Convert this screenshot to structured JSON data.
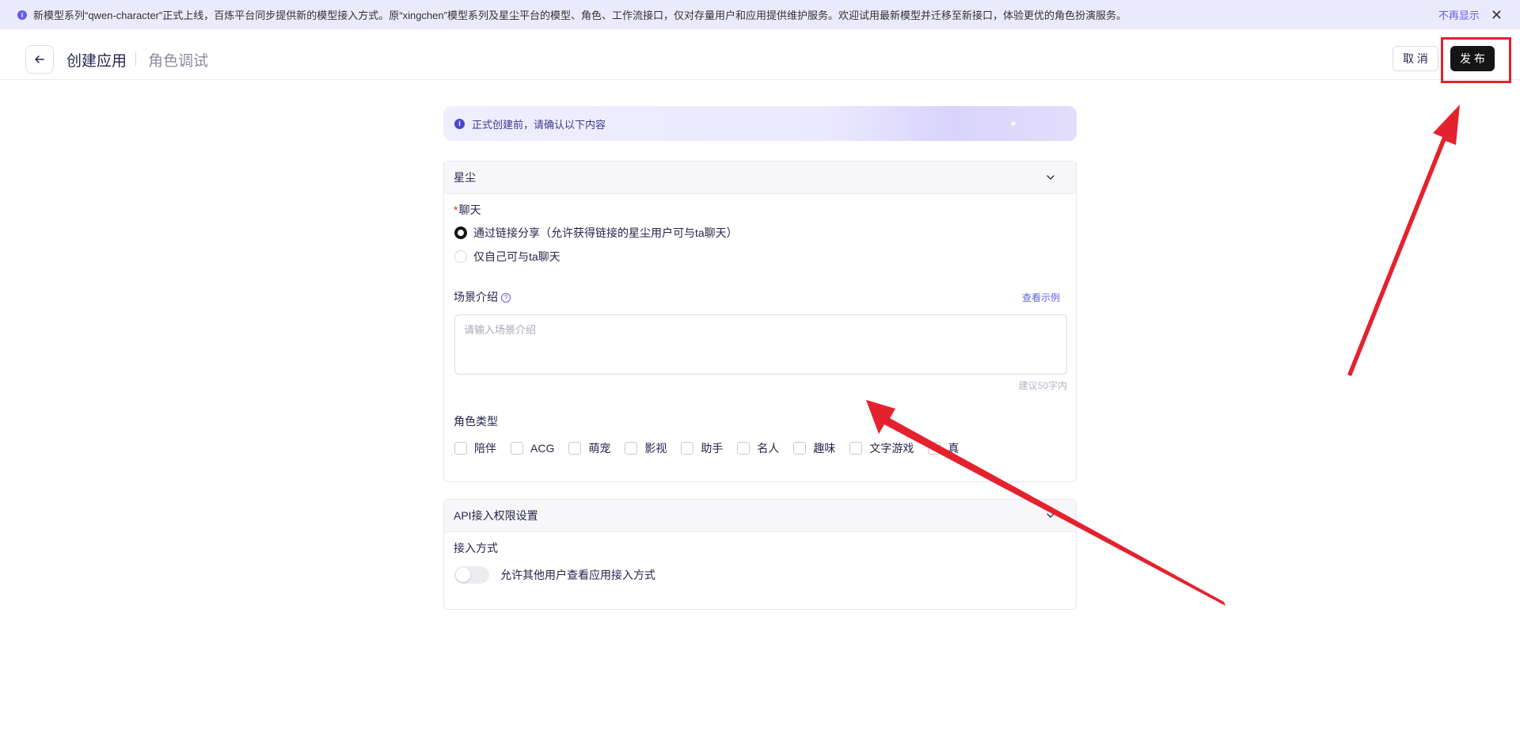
{
  "notice": {
    "text": "新模型系列“qwen-character”正式上线，百炼平台同步提供新的模型接入方式。原“xingchen”模型系列及星尘平台的模型、角色、工作流接口，仅对存量用户和应用提供维护服务。欢迎试用最新模型并迁移至新接口，体验更优的角色扮演服务。",
    "dismiss_label": "不再显示",
    "info_glyph": "i",
    "close_glyph": "✕"
  },
  "header": {
    "title": "创建应用",
    "subtitle": "角色调试",
    "cancel_label": "取 消",
    "publish_label": "发 布"
  },
  "tip": {
    "glyph": "i",
    "text": "正式创建前，请确认以下内容"
  },
  "xingchen_card": {
    "title": "星尘",
    "chat_required_mark": "*",
    "chat_label": "聊天",
    "radio_options": [
      {
        "label": "通过链接分享（允许获得链接的星尘用户可与ta聊天）",
        "selected": true
      },
      {
        "label": "仅自己可与ta聊天",
        "selected": false
      }
    ],
    "scene_label": "场景介绍",
    "help_glyph": "?",
    "example_link": "查看示例",
    "scene_placeholder": "请输入场景介绍",
    "scene_value": "",
    "scene_hint": "建议50字内",
    "role_type_label": "角色类型",
    "role_types": [
      "陪伴",
      "ACG",
      "萌宠",
      "影视",
      "助手",
      "名人",
      "趣味",
      "文字游戏",
      "真"
    ]
  },
  "api_card": {
    "title": "API接入权限设置",
    "access_label": "接入方式",
    "toggle_label": "允许其他用户查看应用接入方式",
    "toggle_on": false
  },
  "annotation": {
    "color": "#e4222e",
    "target": "publish-button"
  }
}
